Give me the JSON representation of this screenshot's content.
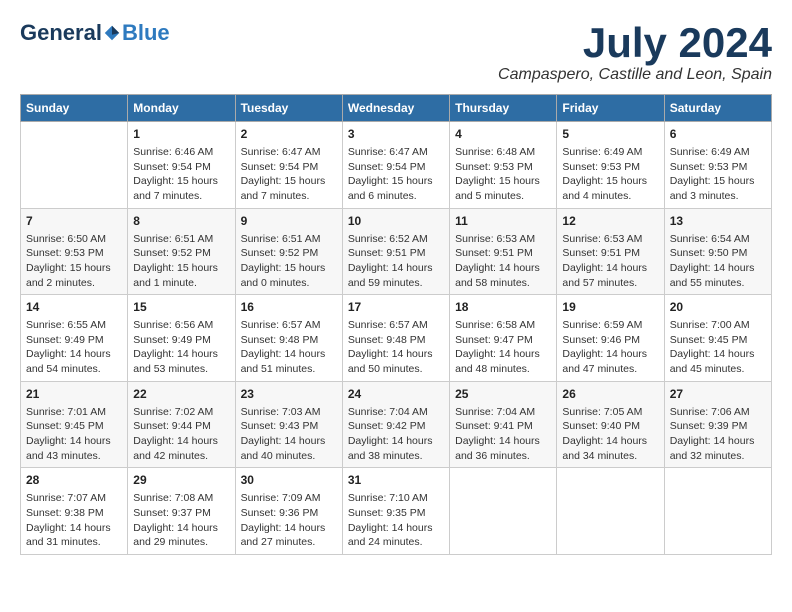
{
  "logo": {
    "general": "General",
    "blue": "Blue"
  },
  "title": "July 2024",
  "subtitle": "Campaspero, Castille and Leon, Spain",
  "weekdays": [
    "Sunday",
    "Monday",
    "Tuesday",
    "Wednesday",
    "Thursday",
    "Friday",
    "Saturday"
  ],
  "weeks": [
    [
      {
        "day": "",
        "info": ""
      },
      {
        "day": "1",
        "info": "Sunrise: 6:46 AM\nSunset: 9:54 PM\nDaylight: 15 hours\nand 7 minutes."
      },
      {
        "day": "2",
        "info": "Sunrise: 6:47 AM\nSunset: 9:54 PM\nDaylight: 15 hours\nand 7 minutes."
      },
      {
        "day": "3",
        "info": "Sunrise: 6:47 AM\nSunset: 9:54 PM\nDaylight: 15 hours\nand 6 minutes."
      },
      {
        "day": "4",
        "info": "Sunrise: 6:48 AM\nSunset: 9:53 PM\nDaylight: 15 hours\nand 5 minutes."
      },
      {
        "day": "5",
        "info": "Sunrise: 6:49 AM\nSunset: 9:53 PM\nDaylight: 15 hours\nand 4 minutes."
      },
      {
        "day": "6",
        "info": "Sunrise: 6:49 AM\nSunset: 9:53 PM\nDaylight: 15 hours\nand 3 minutes."
      }
    ],
    [
      {
        "day": "7",
        "info": "Sunrise: 6:50 AM\nSunset: 9:53 PM\nDaylight: 15 hours\nand 2 minutes."
      },
      {
        "day": "8",
        "info": "Sunrise: 6:51 AM\nSunset: 9:52 PM\nDaylight: 15 hours\nand 1 minute."
      },
      {
        "day": "9",
        "info": "Sunrise: 6:51 AM\nSunset: 9:52 PM\nDaylight: 15 hours\nand 0 minutes."
      },
      {
        "day": "10",
        "info": "Sunrise: 6:52 AM\nSunset: 9:51 PM\nDaylight: 14 hours\nand 59 minutes."
      },
      {
        "day": "11",
        "info": "Sunrise: 6:53 AM\nSunset: 9:51 PM\nDaylight: 14 hours\nand 58 minutes."
      },
      {
        "day": "12",
        "info": "Sunrise: 6:53 AM\nSunset: 9:51 PM\nDaylight: 14 hours\nand 57 minutes."
      },
      {
        "day": "13",
        "info": "Sunrise: 6:54 AM\nSunset: 9:50 PM\nDaylight: 14 hours\nand 55 minutes."
      }
    ],
    [
      {
        "day": "14",
        "info": "Sunrise: 6:55 AM\nSunset: 9:49 PM\nDaylight: 14 hours\nand 54 minutes."
      },
      {
        "day": "15",
        "info": "Sunrise: 6:56 AM\nSunset: 9:49 PM\nDaylight: 14 hours\nand 53 minutes."
      },
      {
        "day": "16",
        "info": "Sunrise: 6:57 AM\nSunset: 9:48 PM\nDaylight: 14 hours\nand 51 minutes."
      },
      {
        "day": "17",
        "info": "Sunrise: 6:57 AM\nSunset: 9:48 PM\nDaylight: 14 hours\nand 50 minutes."
      },
      {
        "day": "18",
        "info": "Sunrise: 6:58 AM\nSunset: 9:47 PM\nDaylight: 14 hours\nand 48 minutes."
      },
      {
        "day": "19",
        "info": "Sunrise: 6:59 AM\nSunset: 9:46 PM\nDaylight: 14 hours\nand 47 minutes."
      },
      {
        "day": "20",
        "info": "Sunrise: 7:00 AM\nSunset: 9:45 PM\nDaylight: 14 hours\nand 45 minutes."
      }
    ],
    [
      {
        "day": "21",
        "info": "Sunrise: 7:01 AM\nSunset: 9:45 PM\nDaylight: 14 hours\nand 43 minutes."
      },
      {
        "day": "22",
        "info": "Sunrise: 7:02 AM\nSunset: 9:44 PM\nDaylight: 14 hours\nand 42 minutes."
      },
      {
        "day": "23",
        "info": "Sunrise: 7:03 AM\nSunset: 9:43 PM\nDaylight: 14 hours\nand 40 minutes."
      },
      {
        "day": "24",
        "info": "Sunrise: 7:04 AM\nSunset: 9:42 PM\nDaylight: 14 hours\nand 38 minutes."
      },
      {
        "day": "25",
        "info": "Sunrise: 7:04 AM\nSunset: 9:41 PM\nDaylight: 14 hours\nand 36 minutes."
      },
      {
        "day": "26",
        "info": "Sunrise: 7:05 AM\nSunset: 9:40 PM\nDaylight: 14 hours\nand 34 minutes."
      },
      {
        "day": "27",
        "info": "Sunrise: 7:06 AM\nSunset: 9:39 PM\nDaylight: 14 hours\nand 32 minutes."
      }
    ],
    [
      {
        "day": "28",
        "info": "Sunrise: 7:07 AM\nSunset: 9:38 PM\nDaylight: 14 hours\nand 31 minutes."
      },
      {
        "day": "29",
        "info": "Sunrise: 7:08 AM\nSunset: 9:37 PM\nDaylight: 14 hours\nand 29 minutes."
      },
      {
        "day": "30",
        "info": "Sunrise: 7:09 AM\nSunset: 9:36 PM\nDaylight: 14 hours\nand 27 minutes."
      },
      {
        "day": "31",
        "info": "Sunrise: 7:10 AM\nSunset: 9:35 PM\nDaylight: 14 hours\nand 24 minutes."
      },
      {
        "day": "",
        "info": ""
      },
      {
        "day": "",
        "info": ""
      },
      {
        "day": "",
        "info": ""
      }
    ]
  ]
}
